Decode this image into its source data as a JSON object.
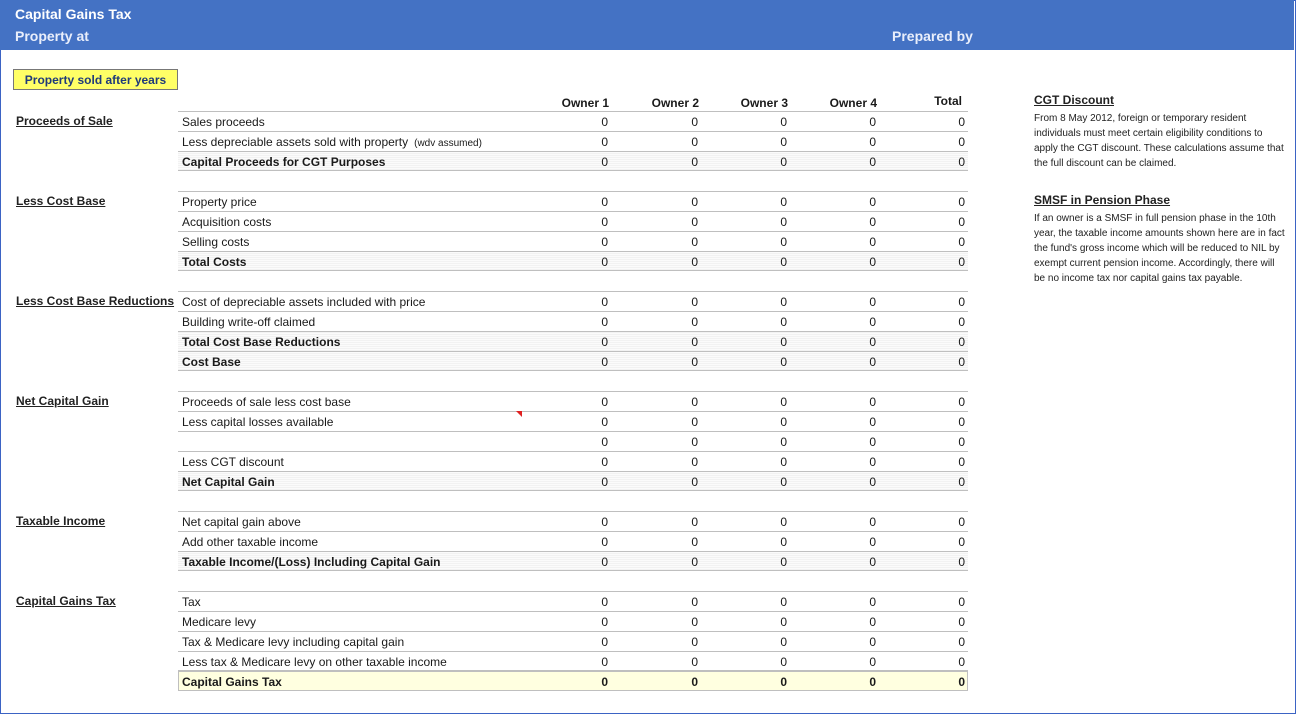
{
  "header": {
    "title": "Capital Gains Tax",
    "property_at": "Property at",
    "prepared_by": "Prepared by"
  },
  "sold_banner": "Property sold after  years",
  "columns": [
    "Owner 1",
    "Owner 2",
    "Owner 3",
    "Owner 4",
    "Total"
  ],
  "sections": [
    {
      "label": "Proceeds of Sale",
      "rows": [
        {
          "label": "Sales proceeds",
          "note": "",
          "values": [
            "0",
            "0",
            "0",
            "0",
            "0"
          ],
          "style": "normal"
        },
        {
          "label": "Less depreciable assets sold with property",
          "note": "(wdv assumed)",
          "values": [
            "0",
            "0",
            "0",
            "0",
            "0"
          ],
          "style": "normal"
        },
        {
          "label": "Capital Proceeds for CGT Purposes",
          "note": "",
          "values": [
            "0",
            "0",
            "0",
            "0",
            "0"
          ],
          "style": "total"
        }
      ]
    },
    {
      "label": "Less Cost Base",
      "rows": [
        {
          "label": "Property price",
          "note": "",
          "values": [
            "0",
            "0",
            "0",
            "0",
            "0"
          ],
          "style": "normal"
        },
        {
          "label": "Acquisition costs",
          "note": "",
          "values": [
            "0",
            "0",
            "0",
            "0",
            "0"
          ],
          "style": "normal"
        },
        {
          "label": "Selling costs",
          "note": "",
          "values": [
            "0",
            "0",
            "0",
            "0",
            "0"
          ],
          "style": "normal"
        },
        {
          "label": "Total Costs",
          "note": "",
          "values": [
            "0",
            "0",
            "0",
            "0",
            "0"
          ],
          "style": "total"
        }
      ]
    },
    {
      "label": "Less Cost Base Reductions",
      "rows": [
        {
          "label": "Cost of depreciable assets included with price",
          "note": "",
          "values": [
            "0",
            "0",
            "0",
            "0",
            "0"
          ],
          "style": "normal"
        },
        {
          "label": "Building write-off claimed",
          "note": "",
          "values": [
            "0",
            "0",
            "0",
            "0",
            "0"
          ],
          "style": "normal"
        },
        {
          "label": "Total Cost Base Reductions",
          "note": "",
          "values": [
            "0",
            "0",
            "0",
            "0",
            "0"
          ],
          "style": "total"
        },
        {
          "label": "Cost Base",
          "note": "",
          "values": [
            "0",
            "0",
            "0",
            "0",
            "0"
          ],
          "style": "total"
        }
      ]
    },
    {
      "label": "Net Capital Gain",
      "rows": [
        {
          "label": "Proceeds of sale less cost base",
          "note": "",
          "values": [
            "0",
            "0",
            "0",
            "0",
            "0"
          ],
          "style": "normal"
        },
        {
          "label": "Less capital losses available",
          "note": "",
          "values": [
            "0",
            "0",
            "0",
            "0",
            "0"
          ],
          "style": "normal"
        },
        {
          "label": "",
          "note": "",
          "values": [
            "0",
            "0",
            "0",
            "0",
            "0"
          ],
          "style": "normal"
        },
        {
          "label": "Less CGT discount",
          "note": "",
          "values": [
            "0",
            "0",
            "0",
            "0",
            "0"
          ],
          "style": "normal"
        },
        {
          "label": "Net Capital Gain",
          "note": "",
          "values": [
            "0",
            "0",
            "0",
            "0",
            "0"
          ],
          "style": "total"
        }
      ]
    },
    {
      "label": "Taxable Income",
      "rows": [
        {
          "label": "Net capital gain above",
          "note": "",
          "values": [
            "0",
            "0",
            "0",
            "0",
            "0"
          ],
          "style": "normal"
        },
        {
          "label": "Add other taxable income",
          "note": "",
          "values": [
            "0",
            "0",
            "0",
            "0",
            "0"
          ],
          "style": "normal"
        },
        {
          "label": "Taxable Income/(Loss) Including Capital Gain",
          "note": "",
          "values": [
            "0",
            "0",
            "0",
            "0",
            "0"
          ],
          "style": "total"
        }
      ]
    },
    {
      "label": "Capital Gains Tax",
      "rows": [
        {
          "label": "Tax",
          "note": "",
          "values": [
            "0",
            "0",
            "0",
            "0",
            "0"
          ],
          "style": "normal"
        },
        {
          "label": "Medicare levy",
          "note": "",
          "values": [
            "0",
            "0",
            "0",
            "0",
            "0"
          ],
          "style": "normal"
        },
        {
          "label": "Tax & Medicare levy including capital gain",
          "note": "",
          "values": [
            "0",
            "0",
            "0",
            "0",
            "0"
          ],
          "style": "normal"
        },
        {
          "label": "Less tax & Medicare levy on other taxable income",
          "note": "",
          "values": [
            "0",
            "0",
            "0",
            "0",
            "0"
          ],
          "style": "normal"
        },
        {
          "label": "Capital Gains Tax",
          "note": "",
          "values": [
            "0",
            "0",
            "0",
            "0",
            "0"
          ],
          "style": "final"
        }
      ]
    }
  ],
  "sidebar": {
    "cgt_discount": {
      "heading": "CGT Discount",
      "text": "From 8 May 2012, foreign or temporary resident individuals must meet certain eligibility conditions to apply the CGT discount.  These calculations assume that the full discount can be claimed."
    },
    "smsf": {
      "heading": "SMSF in Pension Phase",
      "text": "If an owner is a SMSF in full pension phase in the 10th year, the taxable income amounts shown here are in fact the fund's gross income which will be reduced to NIL by exempt current pension income. Accordingly, there will be no income tax nor capital gains tax payable."
    }
  }
}
